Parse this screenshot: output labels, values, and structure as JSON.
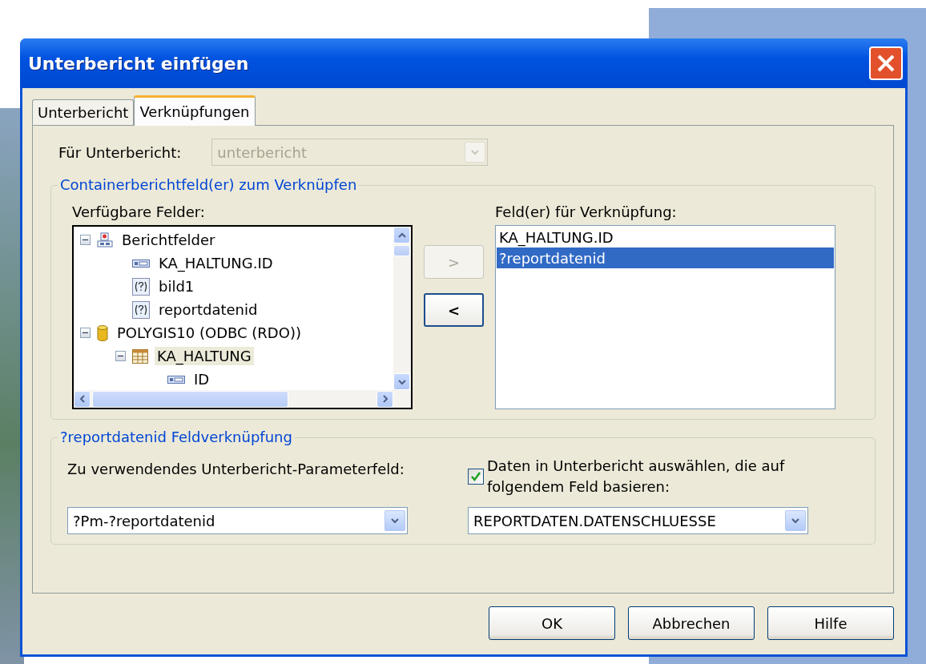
{
  "window": {
    "title": "Unterbericht einfügen"
  },
  "tabs": [
    {
      "label": "Unterbericht",
      "selected": false
    },
    {
      "label": "Verknüpfungen",
      "selected": true
    }
  ],
  "subreport": {
    "label": "Für Unterbericht:",
    "value": "unterbericht",
    "disabled": true
  },
  "container_group": {
    "title": "Containerberichtfeld(er) zum Verknüpfen",
    "available_label": "Verfügbare Felder:",
    "tree": [
      {
        "label": "Berichtfelder",
        "kind": "group",
        "expanded": true,
        "selected": false,
        "children": [
          {
            "label": "KA_HALTUNG.ID",
            "kind": "field",
            "selected": false
          },
          {
            "label": "bild1",
            "kind": "parameter",
            "selected": false
          },
          {
            "label": "reportdatenid",
            "kind": "parameter",
            "selected": false
          }
        ]
      },
      {
        "label": "POLYGIS10 (ODBC (RDO))",
        "kind": "database",
        "expanded": true,
        "selected": false,
        "children": [
          {
            "label": "KA_HALTUNG",
            "kind": "table",
            "expanded": true,
            "selected": true,
            "children": [
              {
                "label": "ID",
                "kind": "field",
                "selected": false
              }
            ]
          }
        ]
      }
    ],
    "move_buttons": [
      {
        "label": ">",
        "disabled": true
      },
      {
        "label": "<",
        "disabled": false
      }
    ],
    "linked_label": "Feld(er) für Verknüpfung:",
    "linked": [
      {
        "label": "KA_HALTUNG.ID",
        "selected": false
      },
      {
        "label": "?reportdatenid",
        "selected": true
      }
    ]
  },
  "link_group": {
    "title": "?reportdatenid Feldverknüpfung",
    "param_label": "Zu verwendendes Unterbericht-Parameterfeld:",
    "param_value": "?Pm-?reportdatenid",
    "checkbox": {
      "label": "Daten in Unterbericht auswählen, die auf folgendem Feld basieren:",
      "checked": true
    },
    "field_value": "REPORTDATEN.DATENSCHLUESSE"
  },
  "buttons": [
    {
      "label": "OK"
    },
    {
      "label": "Abbrechen"
    },
    {
      "label": "Hilfe"
    }
  ]
}
